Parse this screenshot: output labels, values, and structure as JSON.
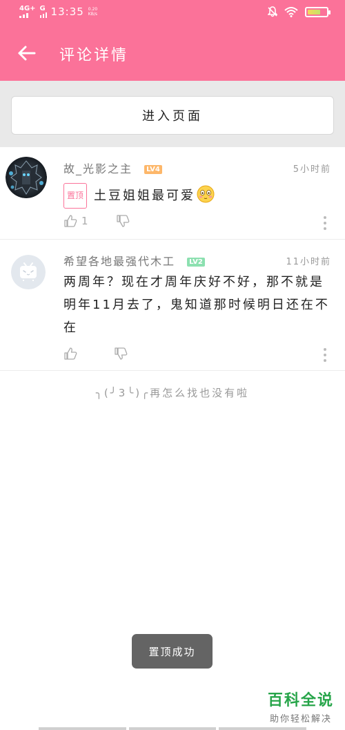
{
  "status_bar": {
    "network_4g": "4G+",
    "network_g": "G",
    "time": "13:35",
    "speed_value": "0.20",
    "speed_unit": "KB/s",
    "battery_level": 0.7
  },
  "toolbar": {
    "title": "评论详情",
    "back_icon": "arrow-left-icon"
  },
  "enter_button": {
    "label": "进入页面"
  },
  "comments": [
    {
      "author": "故_光影之主",
      "level": "LV4",
      "time": "5小时前",
      "badge": "置顶",
      "text": "土豆姐姐最可爱",
      "likes": "1",
      "avatar_icon": "mech-robot-avatar"
    },
    {
      "author": "希望各地最强代木工",
      "level": "LV2",
      "time": "11小时前",
      "text": "两周年？现在才周年庆好不好，那不就是明年11月去了，鬼知道那时候明日还在不在",
      "likes": "",
      "avatar_icon": "bilibili-tv-avatar"
    }
  ],
  "no_more_text": "╮(╯3╰)╭再怎么找也没有啦",
  "toast": "置顶成功",
  "watermark": {
    "title": "百科全说",
    "subtitle": "助你轻松解决"
  },
  "colors": {
    "brand_pink": "#fb7299",
    "level4": "#fdb76a",
    "level2": "#8ce0b0",
    "watermark_green": "#27a54a"
  }
}
